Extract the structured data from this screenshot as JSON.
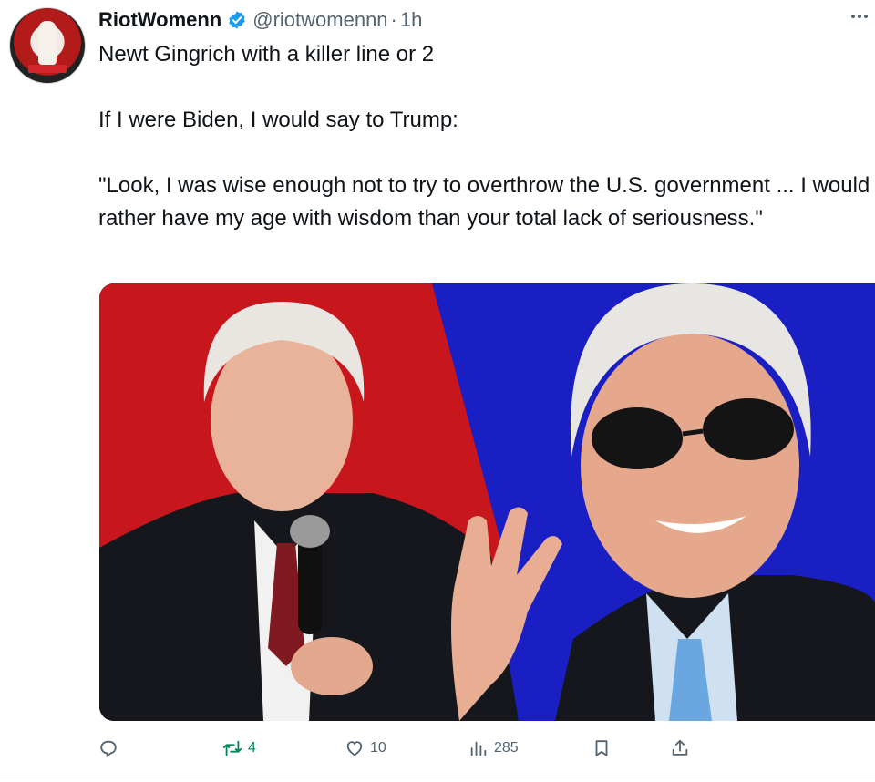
{
  "author": {
    "name": "RiotWomenn",
    "handle": "@riotwomennn",
    "separator": "·",
    "time": "1h",
    "verified_icon": "verified-badge-icon"
  },
  "tweet": {
    "text": "Newt Gingrich with a killer line or 2\n\nIf I were Biden, I would say to Trump:\n\n\"Look, I was wise enough not to try to overthrow the U.S. government ... I would rather have my age with wisdom than your total lack of seriousness.\""
  },
  "actions": {
    "reply": {
      "icon": "reply-icon",
      "count": ""
    },
    "retweet": {
      "icon": "retweet-icon",
      "count": "4"
    },
    "like": {
      "icon": "heart-icon",
      "count": "10"
    },
    "views": {
      "icon": "views-chart-icon",
      "count": "285"
    },
    "bookmark": {
      "icon": "bookmark-icon"
    },
    "share": {
      "icon": "share-icon"
    }
  },
  "colors": {
    "text": "#0f1419",
    "secondary": "#536471",
    "verified": "#1d9bf0",
    "retweet_active": "#00875a",
    "media_left_bg": "#c8161d",
    "media_right_bg": "#1a1fc4"
  }
}
